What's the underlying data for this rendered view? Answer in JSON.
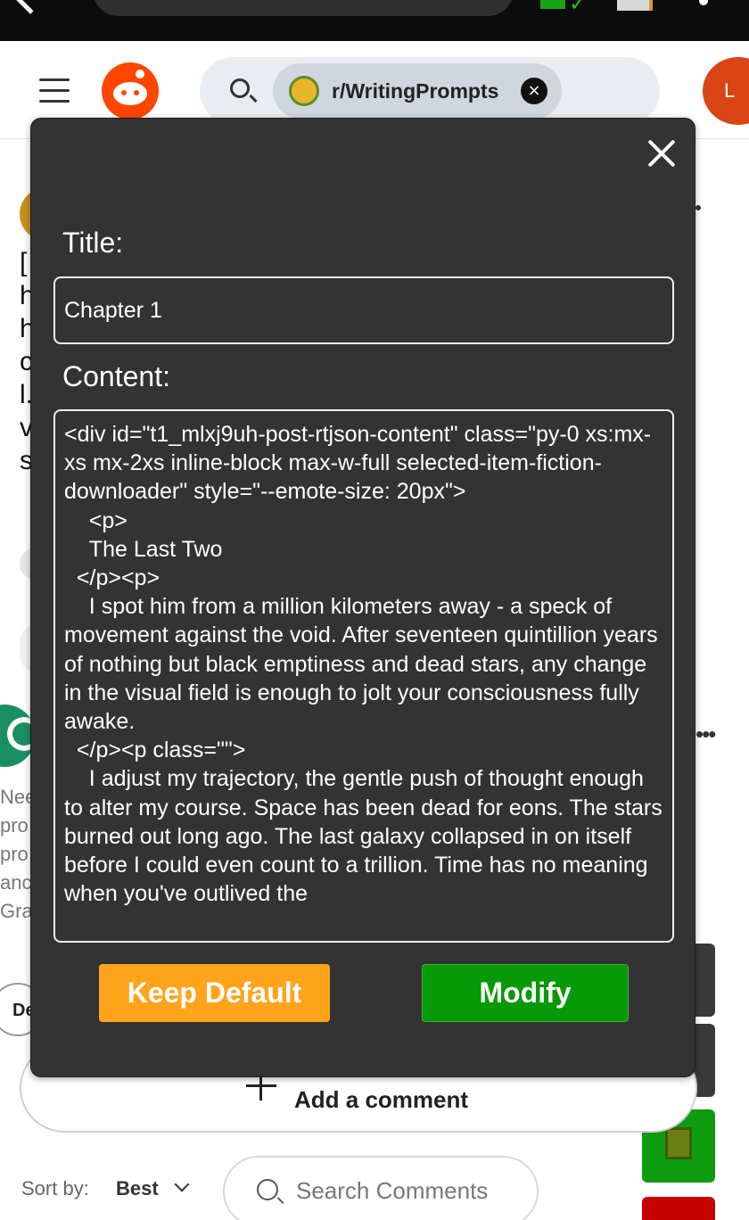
{
  "header": {
    "subreddit_chip": "r/WritingPrompts",
    "profile_initial": "L"
  },
  "background": {
    "left_letters": [
      "[",
      "h",
      "h",
      "c",
      "l.",
      "v",
      "s"
    ],
    "left_text": [
      "Nee",
      "pro",
      "pro",
      "anc",
      "Gra"
    ],
    "de_label": "De",
    "add_comment": "Add a comment",
    "sort_label": "Sort by:",
    "sort_value": "Best",
    "search_comments_placeholder": "Search Comments"
  },
  "modal": {
    "title_label": "Title:",
    "title_value": "Chapter 1",
    "content_label": "Content:",
    "content_value": "<div id=\"t1_mlxj9uh-post-rtjson-content\" class=\"py-0 xs:mx-xs mx-2xs inline-block max-w-full selected-item-fiction-downloader\" style=\"--emote-size: 20px\">\n    <p>\n    The Last Two\n  </p><p>\n    I spot him from a million kilometers away - a speck of movement against the void. After seventeen quintillion years of nothing but black emptiness and dead stars, any change in the visual field is enough to jolt your consciousness fully awake.\n  </p><p class=\"\">\n    I adjust my trajectory, the gentle push of thought enough to alter my course. Space has been dead for eons. The stars burned out long ago. The last galaxy collapsed in on itself before I could even count to a trillion. Time has no meaning when you've outlived the",
    "keep_default_label": "Keep Default",
    "modify_label": "Modify"
  },
  "colors": {
    "modal_bg": "#333333",
    "keep_default": "#ffa41b",
    "modify": "#079907",
    "reddit_orange": "#ff4500"
  }
}
